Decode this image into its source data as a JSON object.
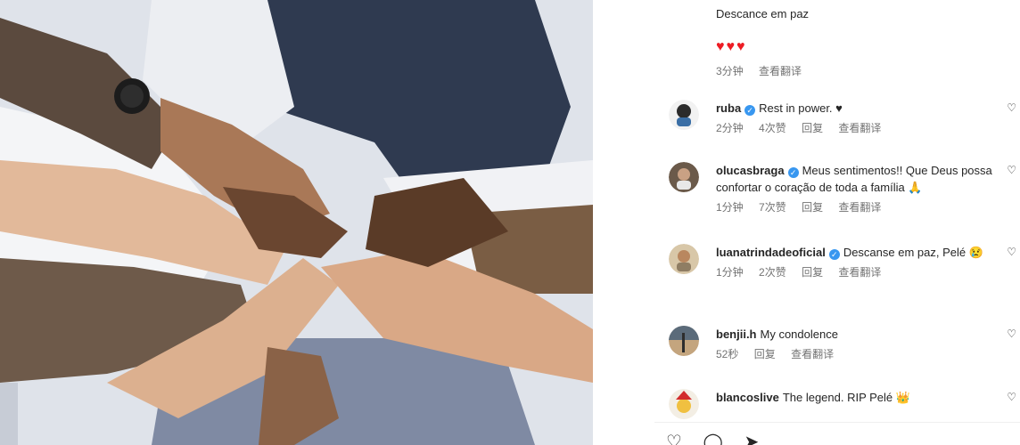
{
  "post_photo": {
    "alt": ""
  },
  "top_comment": {
    "text": "Descance em paz",
    "emoji": "♥♥♥",
    "time": "3分钟",
    "translate": "查看翻译"
  },
  "comments": [
    {
      "username": "ruba",
      "verified": true,
      "text": "Rest in power. ♥",
      "time": "2分钟",
      "likes": "4次赞",
      "reply": "回复",
      "translate": "查看翻译",
      "avatar_color": "#2b2b2b"
    },
    {
      "username": "olucasbraga",
      "verified": true,
      "text": "Meus sentimentos!! Que Deus possa confortar o coração de toda a família 🙏",
      "time": "1分钟",
      "likes": "7次赞",
      "reply": "回复",
      "translate": "查看翻译",
      "avatar_color": "#6b5a4a"
    },
    {
      "username": "luanatrindadeoficial",
      "verified": true,
      "text": "Descanse em paz, Pelé 😢",
      "time": "1分钟",
      "likes": "2次赞",
      "reply": "回复",
      "translate": "查看翻译",
      "avatar_color": "#c9b08a"
    },
    {
      "username": "benjii.h",
      "verified": false,
      "text": "My condolence",
      "time": "52秒",
      "likes": "",
      "reply": "回复",
      "translate": "查看翻译",
      "avatar_color": "#4a4a52"
    },
    {
      "username": "blancoslive",
      "verified": false,
      "text": "The legend. RIP Pelé 👑",
      "time": "",
      "likes": "",
      "reply": "",
      "translate": "",
      "avatar_color": "#e8e0d0"
    }
  ],
  "icons": {
    "like": "heart-outline-icon",
    "comment": "comment-icon",
    "share": "share-icon"
  },
  "colors": {
    "verified": "#3897f0",
    "meta": "#737373",
    "heart": "#ed1c24"
  }
}
